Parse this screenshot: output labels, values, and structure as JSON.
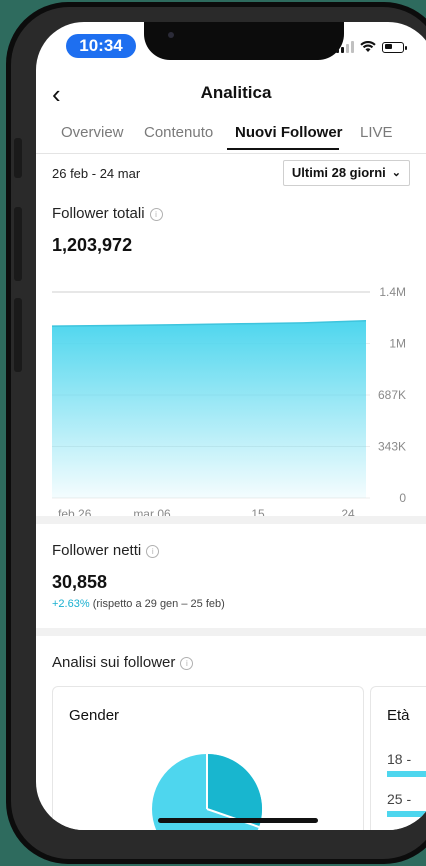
{
  "status": {
    "time": "10:34"
  },
  "header": {
    "title": "Analitica"
  },
  "tabs": [
    {
      "label": "Overview",
      "active": false
    },
    {
      "label": "Contenuto",
      "active": false
    },
    {
      "label": "Nuovi Follower",
      "active": true
    },
    {
      "label": "LIVE",
      "active": false
    }
  ],
  "filter": {
    "date_range": "26 feb - 24 mar",
    "period": "Ultimi 28 giorni"
  },
  "total_followers": {
    "title": "Follower totali",
    "value": "1,203,972"
  },
  "chart_data": {
    "type": "area",
    "x": [
      "feb 26",
      "mar 06",
      "15",
      "24"
    ],
    "values": [
      1168000,
      1172000,
      1178000,
      1184000,
      1190000,
      1203972
    ],
    "ylim": [
      0,
      1400000
    ],
    "y_ticks": [
      "1.4M",
      "1M",
      "687K",
      "343K",
      "0"
    ],
    "x_ticks": [
      "feb 26",
      "mar 06",
      "15",
      "24"
    ],
    "grid": true,
    "color": "#4ed6ee"
  },
  "net_followers": {
    "title": "Follower netti",
    "value": "30,858",
    "change_pct": "+2.63%",
    "change_note": "(rispetto a 29 gen – 25 feb)"
  },
  "insights": {
    "title": "Analisi sui follower",
    "gender_title": "Gender",
    "age_title": "Età",
    "age_rows": [
      "18 -",
      "25 -"
    ]
  },
  "colors": {
    "accent": "#4ed6ee",
    "accent_dark": "#1ab0d0",
    "status_pill": "#1e6ff0"
  }
}
